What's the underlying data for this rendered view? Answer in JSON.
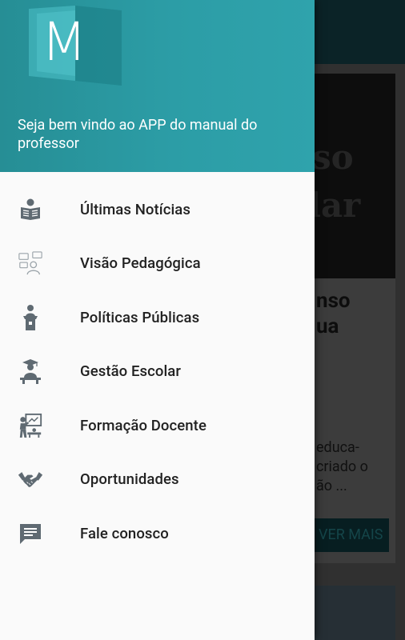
{
  "background": {
    "card_image_text": [
      "so",
      "lar"
    ],
    "headline": [
      "nso",
      "ua"
    ],
    "excerpt": [
      "educa-",
      "criado o",
      "ão ..."
    ],
    "read_more_label": "VER MAIS"
  },
  "drawer": {
    "header": {
      "logo_letter": "M",
      "welcome_text": "Seja bem vindo ao APP do manual do professor"
    },
    "items": [
      {
        "label": "Últimas Notícias",
        "icon": "newspaper-reader-icon"
      },
      {
        "label": "Visão Pedagógica",
        "icon": "pedagogy-vision-icon"
      },
      {
        "label": "Políticas Públicas",
        "icon": "speaker-podium-icon"
      },
      {
        "label": "Gestão Escolar",
        "icon": "graduate-desk-icon"
      },
      {
        "label": "Formação Docente",
        "icon": "teacher-board-icon"
      },
      {
        "label": "Oportunidades",
        "icon": "handshake-icon"
      },
      {
        "label": "Fale conosco",
        "icon": "chat-message-icon"
      }
    ]
  },
  "colors": {
    "header_start": "#268e95",
    "header_end": "#2fa3ac",
    "icon_gray": "#5f6a72",
    "text_dark": "#212121"
  }
}
